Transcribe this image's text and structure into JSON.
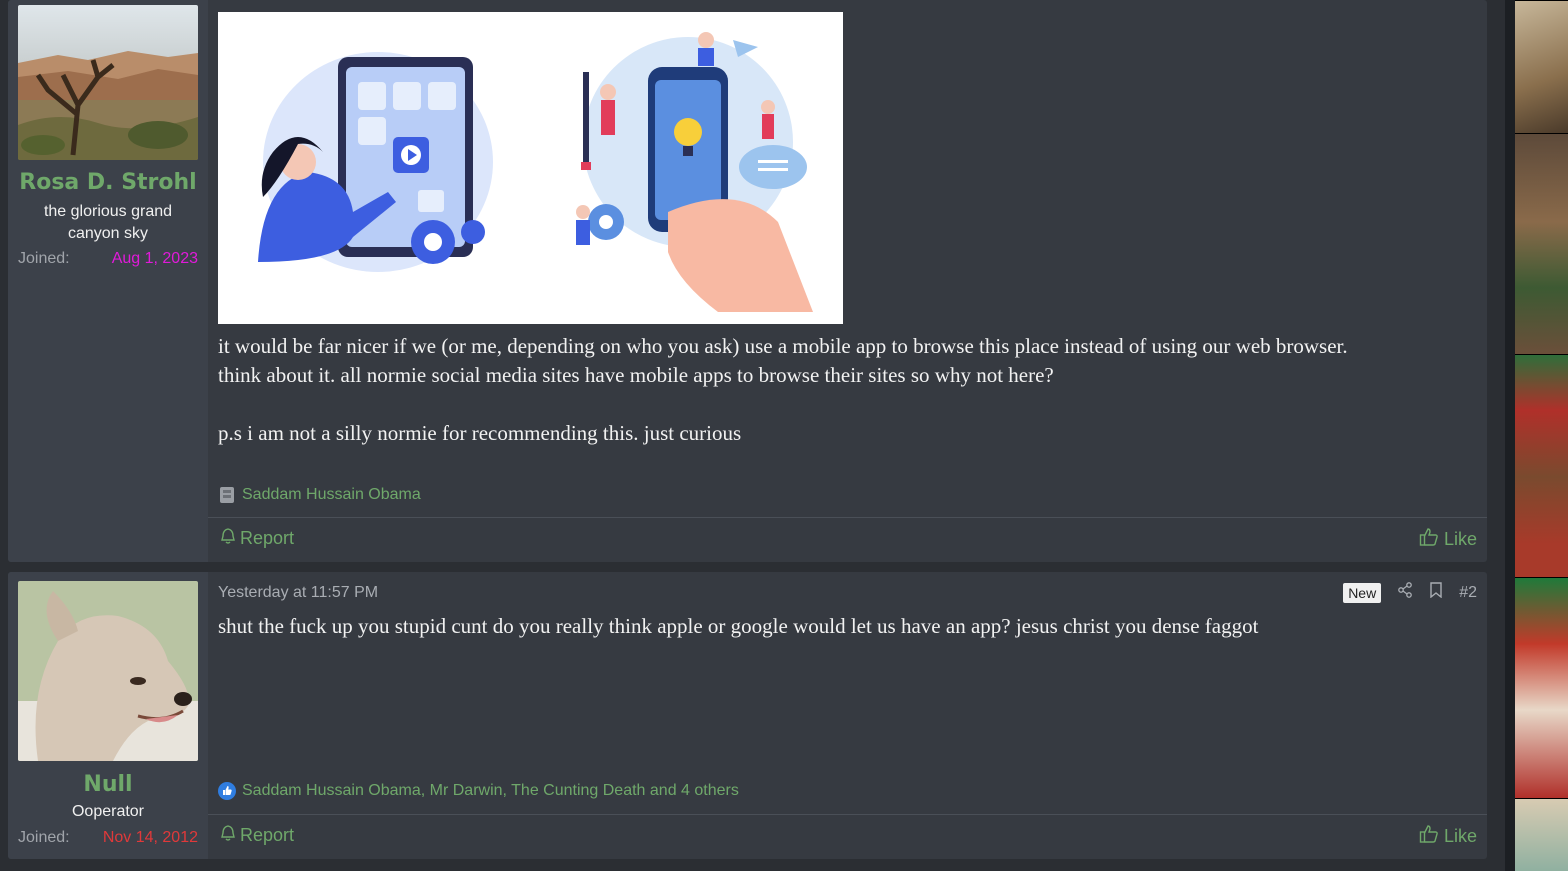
{
  "posts": [
    {
      "username": "Rosa D. Strohl",
      "user_title": "the glorious grand canyon sky",
      "joined_label": "Joined:",
      "joined_date": "Aug 1, 2023",
      "joined_color": "#e01ad9",
      "avatar_icon": "grand-canyon-photo",
      "attachment_icon": "mobile-app-illustration",
      "body_lines": [
        "it would be far nicer if we (or me, depending on who you ask) use a mobile app to browse this place instead of using our web browser.",
        "think about it. all normie social media sites have mobile apps to browse their sites so why not here?",
        "",
        "p.s i am not a silly normie for recommending this. just curious"
      ],
      "reactions_text": "Saddam Hussain Obama",
      "reaction_icon": "reaction-emoji-icon",
      "report_label": "Report",
      "like_label": "Like"
    },
    {
      "username": "Null",
      "user_title": "Ooperator",
      "joined_label": "Joined:",
      "joined_date": "Nov 14, 2012",
      "joined_color": "#e0393a",
      "avatar_icon": "dog-drawing",
      "date": "Yesterday at 11:57 PM",
      "new_badge": "New",
      "post_number": "#2",
      "body_lines": [
        "shut the fuck up you stupid cunt do you really think apple or google would let us have an app? jesus christ you dense faggot"
      ],
      "reactions_text": "Saddam Hussain Obama, Mr Darwin, The Cunting Death and 4 others",
      "reaction_icon": "like-reaction-icon",
      "report_label": "Report",
      "like_label": "Like"
    }
  ],
  "colors": {
    "accent_green": "#6fa86a",
    "post_bg": "#363a41",
    "user_col_bg": "#3c414a",
    "page_bg": "#2b2e33"
  }
}
